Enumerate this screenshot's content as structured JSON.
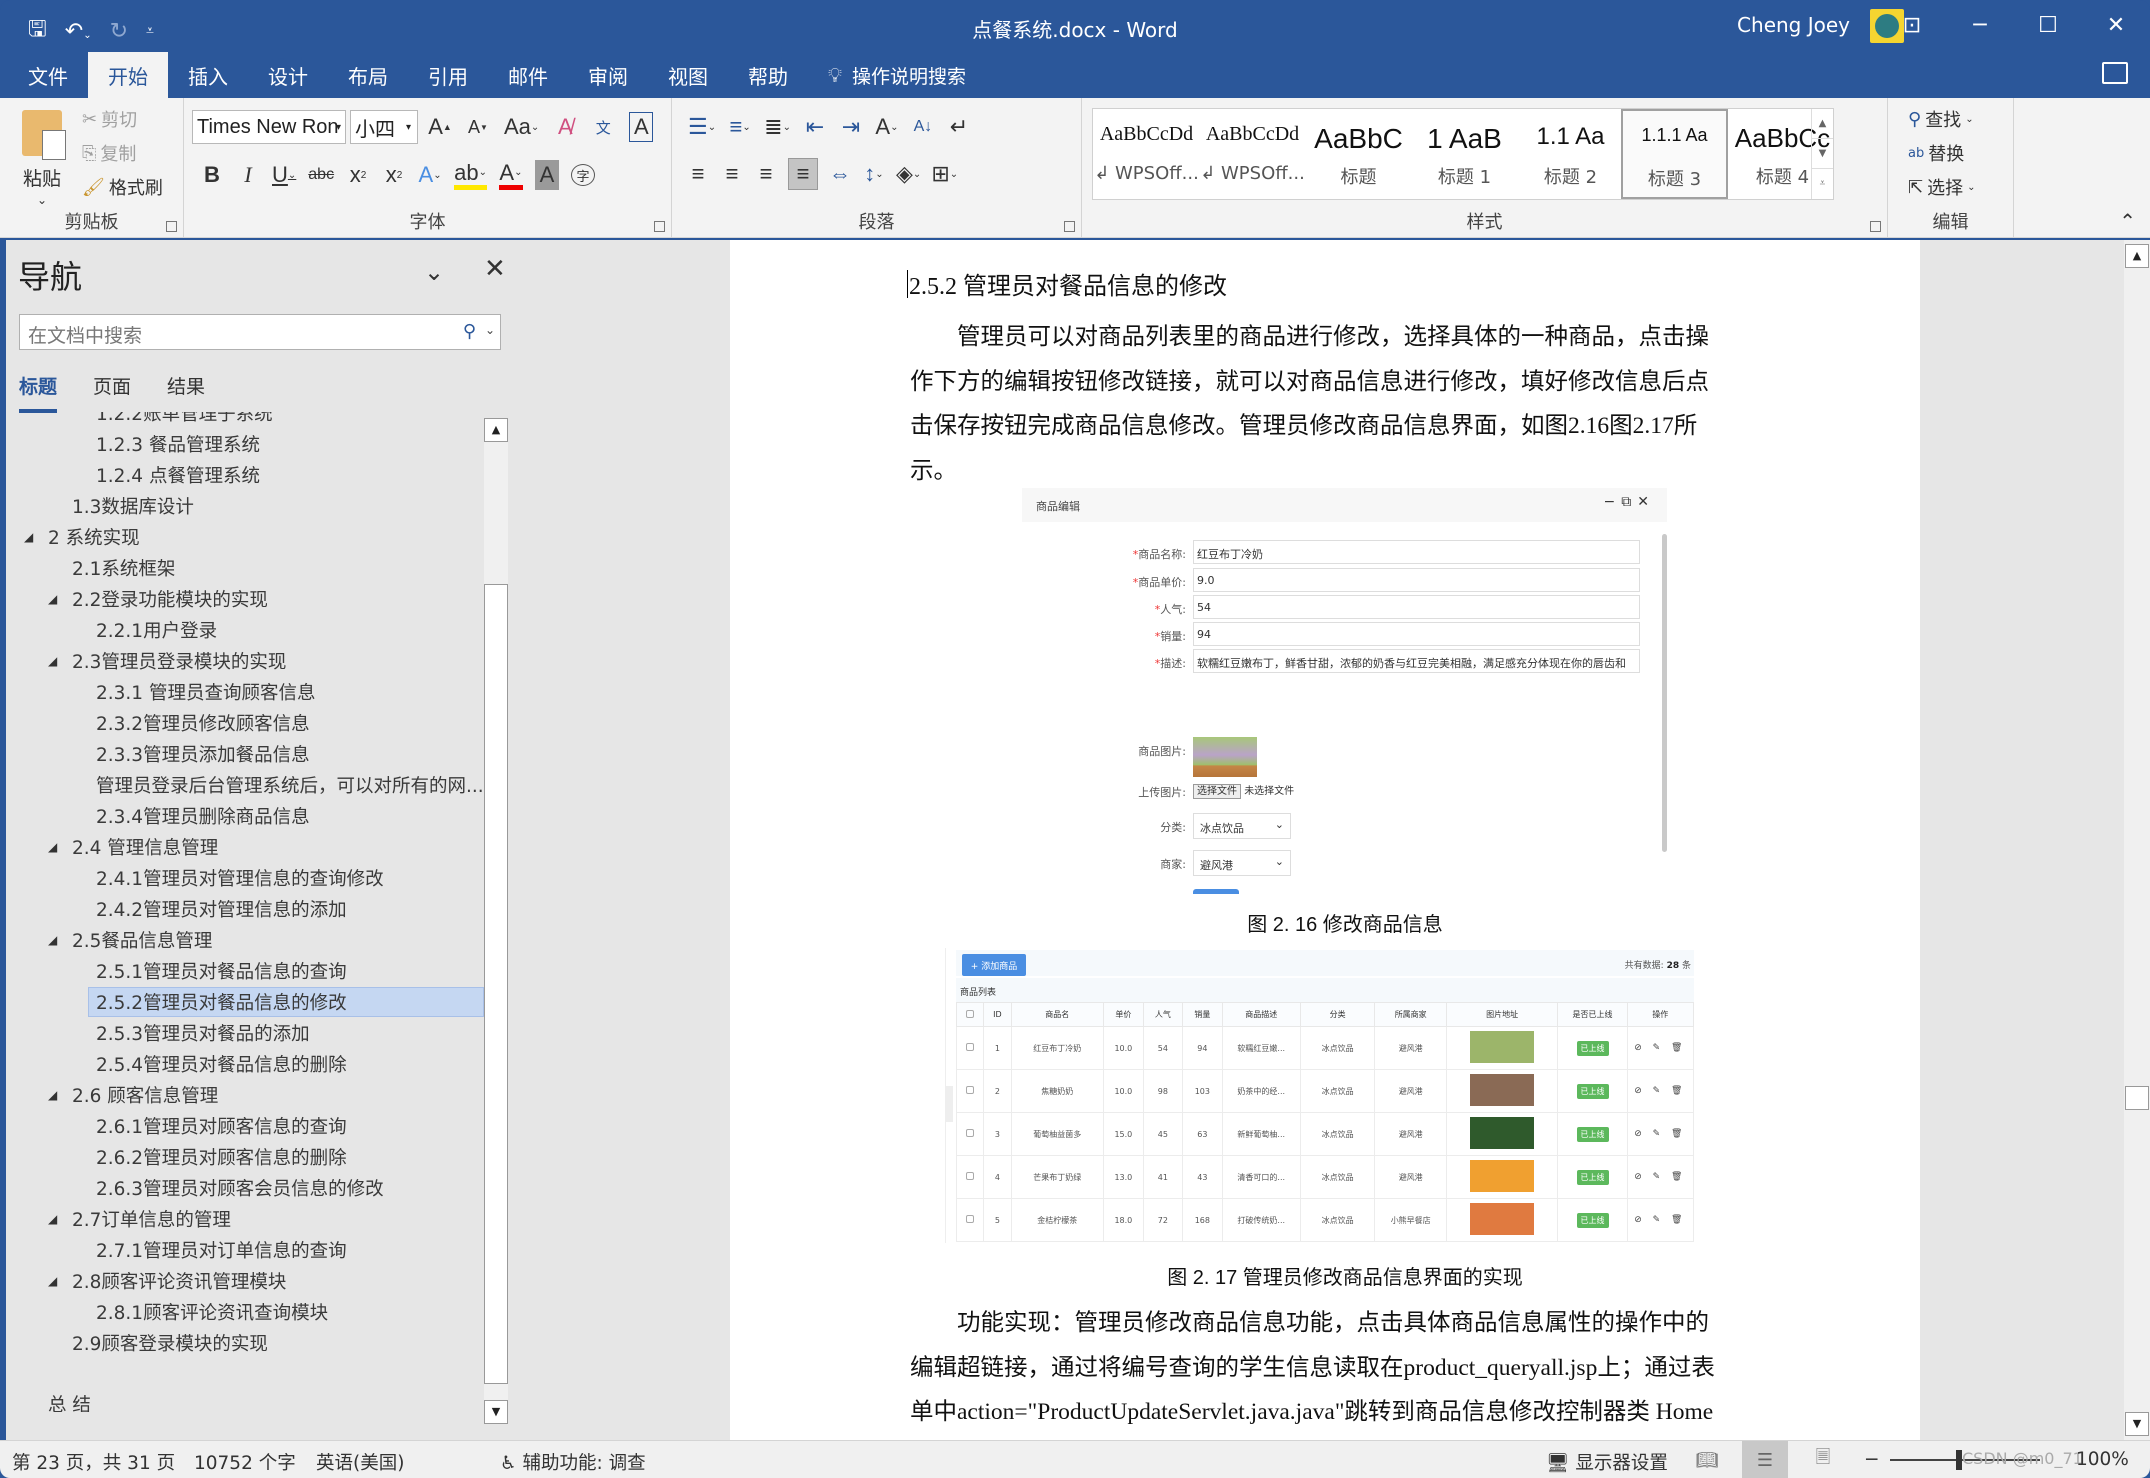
{
  "window": {
    "title": "点餐系统.docx  -  Word",
    "user_name": "Cheng Joey",
    "buttons": {
      "ribbon_display": "⊡",
      "minimize": "─",
      "maximize": "☐",
      "close": "✕"
    }
  },
  "quick_access": {
    "save": "save-icon",
    "undo": "undo-icon",
    "redo": "redo-icon",
    "customize": "customize-icon"
  },
  "menu_tabs": [
    "文件",
    "开始",
    "插入",
    "设计",
    "布局",
    "引用",
    "邮件",
    "审阅",
    "视图",
    "帮助"
  ],
  "active_tab": "开始",
  "tell_me": "操作说明搜索",
  "ribbon": {
    "clipboard": {
      "label": "剪贴板",
      "paste": "粘贴",
      "cut": "剪切",
      "copy": "复制",
      "format_painter": "格式刷"
    },
    "font": {
      "label": "字体",
      "font_name": "Times New Ron",
      "font_size": "小四"
    },
    "paragraph": {
      "label": "段落"
    },
    "styles": {
      "label": "样式",
      "items": [
        {
          "sample": "AaBbCcDd",
          "name": "↲ WPSOff..."
        },
        {
          "sample": "AaBbCcDd",
          "name": "↲ WPSOff..."
        },
        {
          "sample": "AaBbC",
          "name": "标题"
        },
        {
          "sample": "1  AaB",
          "name": "标题 1"
        },
        {
          "sample": "1.1  Aa",
          "name": "标题 2"
        },
        {
          "sample": "1.1.1  Aa",
          "name": "标题 3"
        },
        {
          "sample": "AaBbCc",
          "name": "标题 4"
        }
      ],
      "selected": "标题 3"
    },
    "editing": {
      "label": "编辑",
      "find": "查找",
      "replace": "替换",
      "select": "选择"
    }
  },
  "nav_pane": {
    "title": "导航",
    "search_placeholder": "在文档中搜索",
    "tabs": [
      "标题",
      "页面",
      "结果"
    ],
    "active_tab": "标题",
    "items": [
      {
        "text": "1.2.2账单管理子系统",
        "level": 3,
        "expandable": false,
        "clipped": true
      },
      {
        "text": "1.2.3 餐品管理系统",
        "level": 3,
        "expandable": false
      },
      {
        "text": "1.2.4 点餐管理系统",
        "level": 3,
        "expandable": false
      },
      {
        "text": "1.3数据库设计",
        "level": 2,
        "expandable": false
      },
      {
        "text": "2 系统实现",
        "level": 1,
        "expandable": true
      },
      {
        "text": "2.1系统框架",
        "level": 2,
        "expandable": false
      },
      {
        "text": "2.2登录功能模块的实现",
        "level": 2,
        "expandable": true
      },
      {
        "text": "2.2.1用户登录",
        "level": 3,
        "expandable": false
      },
      {
        "text": "2.3管理员登录模块的实现",
        "level": 2,
        "expandable": true
      },
      {
        "text": "2.3.1 管理员查询顾客信息",
        "level": 3,
        "expandable": false
      },
      {
        "text": "2.3.2管理员修改顾客信息",
        "level": 3,
        "expandable": false
      },
      {
        "text": "2.3.3管理员添加餐品信息",
        "level": 3,
        "expandable": false
      },
      {
        "text": "管理员登录后台管理系统后，可以对所有的网...",
        "level": 3,
        "expandable": false
      },
      {
        "text": "2.3.4管理员删除商品信息",
        "level": 3,
        "expandable": false
      },
      {
        "text": "2.4 管理信息管理",
        "level": 2,
        "expandable": true
      },
      {
        "text": "2.4.1管理员对管理信息的查询修改",
        "level": 3,
        "expandable": false
      },
      {
        "text": "2.4.2管理员对管理信息的添加",
        "level": 3,
        "expandable": false
      },
      {
        "text": "2.5餐品信息管理",
        "level": 2,
        "expandable": true
      },
      {
        "text": "2.5.1管理员对餐品信息的查询",
        "level": 3,
        "expandable": false
      },
      {
        "text": "2.5.2管理员对餐品信息的修改",
        "level": 3,
        "expandable": false,
        "selected": true
      },
      {
        "text": "2.5.3管理员对餐品的添加",
        "level": 3,
        "expandable": false
      },
      {
        "text": "2.5.4管理员对餐品信息的删除",
        "level": 3,
        "expandable": false
      },
      {
        "text": "2.6 顾客信息管理",
        "level": 2,
        "expandable": true
      },
      {
        "text": "2.6.1管理员对顾客信息的查询",
        "level": 3,
        "expandable": false
      },
      {
        "text": "2.6.2管理员对顾客信息的删除",
        "level": 3,
        "expandable": false
      },
      {
        "text": "2.6.3管理员对顾客会员信息的修改",
        "level": 3,
        "expandable": false
      },
      {
        "text": "2.7订单信息的管理",
        "level": 2,
        "expandable": true
      },
      {
        "text": "2.7.1管理员对订单信息的查询",
        "level": 3,
        "expandable": false
      },
      {
        "text": "2.8顾客评论资讯管理模块",
        "level": 2,
        "expandable": true
      },
      {
        "text": "2.8.1顾客评论资讯查询模块",
        "level": 3,
        "expandable": false
      },
      {
        "text": "2.9顾客登录模块的实现",
        "level": 2,
        "expandable": false
      },
      {
        "text": "",
        "level": 0,
        "spacer": true
      },
      {
        "text": "总 结",
        "level": 1,
        "expandable": false
      }
    ]
  },
  "document": {
    "heading": "2.5.2 管理员对餐品信息的修改",
    "para1": [
      "管理员可以对商品列表里的商品进行修改，选择具体的一种商品，点击操",
      "作下方的编辑按钮修改链接，就可以对商品信息进行修改，填好修改信息后点",
      "击保存按钮完成商品信息修改。管理员修改商品信息界面，如图2.16图2.17所",
      "示。"
    ],
    "figure1": {
      "dialog_title": "商品编辑",
      "fields": [
        {
          "label": "商品名称:",
          "required": true,
          "value": "红豆布丁冷奶"
        },
        {
          "label": "商品单价:",
          "required": true,
          "value": "9.0"
        },
        {
          "label": "人气:",
          "required": true,
          "value": "54"
        },
        {
          "label": "销量:",
          "required": true,
          "value": "94"
        },
        {
          "label": "描述:",
          "required": true,
          "value": "软糯红豆嫩布丁，鲜香甘甜，浓郁的奶香与红豆完美相融，满足感充分体现在你的唇齿和"
        }
      ],
      "image_label": "商品图片:",
      "upload_label": "上传图片:",
      "choose_file": "选择文件",
      "no_file": "未选择文件",
      "category_label": "分类:",
      "category_value": "冰点饮品",
      "merchant_label": "商家:",
      "merchant_value": "避风港",
      "caption": "图 2. 16 修改商品信息"
    },
    "figure2": {
      "add_button": "+ 添加商品",
      "total_label": "共有数据:",
      "total_count": "28",
      "total_unit": "条",
      "list_title": "商品列表",
      "columns": [
        "",
        "ID",
        "商品名",
        "单价",
        "人气",
        "销量",
        "商品描述",
        "分类",
        "所属商家",
        "图片地址",
        "是否已上线",
        "操作"
      ],
      "rows": [
        {
          "id": "1",
          "name": "红豆布丁冷奶",
          "price": "10.0",
          "popularity": "54",
          "sales": "94",
          "desc": "软糯红豆嫩...",
          "category": "冰点饮品",
          "merchant": "避风港",
          "online": "已上线",
          "img_color": "#9cb56a"
        },
        {
          "id": "2",
          "name": "焦糖奶奶",
          "price": "10.0",
          "popularity": "98",
          "sales": "103",
          "desc": "奶茶中的经...",
          "category": "冰点饮品",
          "merchant": "避风港",
          "online": "已上线",
          "img_color": "#8a6a55"
        },
        {
          "id": "3",
          "name": "葡萄柚益菌多",
          "price": "15.0",
          "popularity": "45",
          "sales": "63",
          "desc": "新鲜葡萄柚...",
          "category": "冰点饮品",
          "merchant": "避风港",
          "online": "已上线",
          "img_color": "#2f5a2c"
        },
        {
          "id": "4",
          "name": "芒果布丁奶绿",
          "price": "13.0",
          "popularity": "41",
          "sales": "43",
          "desc": "清香可口的...",
          "category": "冰点饮品",
          "merchant": "避风港",
          "online": "已上线",
          "img_color": "#f0a030"
        },
        {
          "id": "5",
          "name": "金桔柠檬茶",
          "price": "18.0",
          "popularity": "72",
          "sales": "168",
          "desc": "打破传统奶...",
          "category": "冰点饮品",
          "merchant": "小熊早餐店",
          "online": "已上线",
          "img_color": "#e07a40"
        }
      ],
      "ops": "⊘ ✎ 🗑",
      "caption": "图 2. 17 管理员修改商品信息界面的实现"
    },
    "para2": [
      "功能实现：管理员修改商品信息功能，点击具体商品信息属性的操作中的",
      "编辑超链接，通过将编号查询的学生信息读取在product_queryall.jsp上；通过表",
      "单中action=\"ProductUpdateServlet.java.java\"跳转到商品信息修改控制器类  Home"
    ]
  },
  "status_bar": {
    "page": "第 23 页，共 31 页",
    "words": "10752 个字",
    "language": "英语(美国)",
    "accessibility": "辅助功能: 调查",
    "display_settings": "显示器设置",
    "zoom": "100%",
    "watermark": "CSDN @m0_71"
  }
}
